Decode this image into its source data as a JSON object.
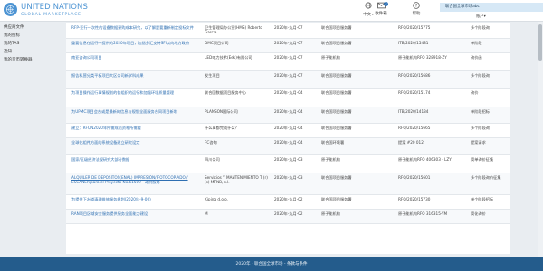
{
  "header": {
    "brand_name": "UNITED NATIONS",
    "brand_sub": "GLOBAL MARKETPLACE",
    "nav": {
      "language": "中文",
      "inbox": "收件箱",
      "inbox_count": "2",
      "help": "帮助"
    },
    "account": {
      "name": "联合国全球市场abc",
      "menu": "账户"
    }
  },
  "sidebar": {
    "items": [
      {
        "label": "供应商文件"
      },
      {
        "label": "我的投标"
      },
      {
        "label": "我的TAS"
      },
      {
        "label": "通知"
      },
      {
        "label": "我的货币转换器"
      }
    ]
  },
  "rows": [
    {
      "title": "RFP-亚行一次性的设备数据采购成本研究，以了解是要重新制定投标文件",
      "agency": "卫生管理局办公室(HMS) Roberto Garcia...",
      "date": "2020年-九月-07",
      "status": "联合国项目服务署",
      "ref": "RFQ/2020/15775",
      "stage": "多个阶段询"
    },
    {
      "title": "重要信息在运行中提供的2020年项目，包括多汇支持SFI以向地方政府",
      "agency": "DMC项目公司",
      "date": "2020年-九月-07",
      "status": "联合国项目服务署",
      "ref": "ITB/2020/15481",
      "stage": "单阶段"
    },
    {
      "title": "南亚咨询公司项目",
      "agency": "LED电力技术(Eek)有限公司",
      "date": "2020年-九月-07",
      "status": "原子能机构",
      "ref": "原子能机构RFQ 328918-ZY",
      "stage": "询价函"
    },
    {
      "title": "报告私营分类平板项目大区公司新学科成果",
      "agency": "发生项目",
      "date": "2020年-九月-07",
      "status": "联合国项目服务署",
      "ref": "RFQ/2020/15686",
      "stage": "多个阶段询"
    },
    {
      "title": "为项目操作运行事情规划的各组织的运行和加强环境质量管理",
      "agency": "联合国数据项目服务中心",
      "date": "2020年-九月-04",
      "status": "联合国项目服务署",
      "ref": "RFQ/2020/15174",
      "stage": "询价"
    },
    {
      "title": "为UPMC项目会合或是最新的信息与规划全面服务合同项目新增",
      "agency": "PLANSON国际公司",
      "date": "2020年-九月-04",
      "status": "联合国项目服务署",
      "ref": "ITB/2020/14134",
      "stage": "单阶段招标"
    },
    {
      "title": "建立：RFQN2020年所需成员资格所需要",
      "agency": "什么事都完成什么？",
      "date": "2020年-九月-04",
      "status": "联合国项目服务署",
      "ref": "RFQ/2020/15665",
      "stage": "多个阶段询"
    },
    {
      "title": "全球化组件方面的系统设备建立研究设定",
      "agency": "FC咨询",
      "date": "2020年-九月-04",
      "status": "联合国环境署",
      "ref": "提案 #20 012",
      "stage": "提案请求"
    },
    {
      "title": "国家/区级经济法规研究大部分数据",
      "agency": "四川公司",
      "date": "2020年-九月-03",
      "status": "原子能机构",
      "ref": "原子能机构RFQ 406303 - LZY",
      "stage": "简单询价征集"
    },
    {
      "title": "ALQUILER DE DEPOSITOS(ENAL) IMPRESIÓN/ FOTOCOPIADO / ESCÁNER para el Proyecto No.61509 - 政府服务",
      "agency": "Servicios Y MANTENIMIENTO T (r)(s) MTNB, s.l.",
      "date": "2020年-九月-03",
      "status": "联合国项目服务署",
      "ref": "RFQ/2020/15601",
      "stage": "多个阶段询价征集"
    },
    {
      "title": "为提供下水道清理维修服务规划(2020年-9-00)",
      "agency": "Kiping d.o.o.",
      "date": "2020年-九月-02",
      "status": "联合国项目服务署",
      "ref": "RFQ/2020/15730",
      "stage": "单个阶段招标"
    },
    {
      "title": "RAN项目区域安全服务提供服务全面能力建设",
      "agency": "M",
      "date": "2020年-九月-02",
      "status": "原子能机构",
      "ref": "原子能机构RFQ 316315-YM",
      "stage": "简化询价"
    }
  ],
  "footer": {
    "copyright": "2020年 - 联合国全球市场 - ",
    "privacy_link": "条款与条件"
  }
}
